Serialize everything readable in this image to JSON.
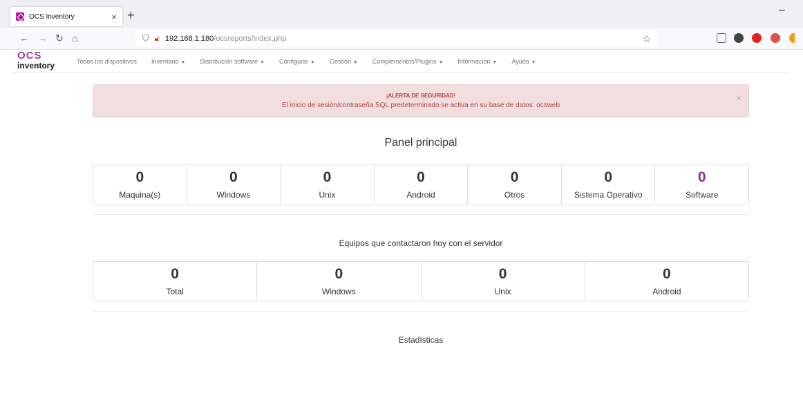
{
  "browser": {
    "tab_title": "OCS Inventory",
    "tab_close": "×",
    "new_tab": "+",
    "minimize": "–",
    "url_host": "192.168.1.180",
    "url_path": "/ocsreports/index.php"
  },
  "logo": {
    "top": "OCS",
    "bottom": "inventory"
  },
  "menu": [
    {
      "label": "Todos los dispositivos",
      "has_caret": false
    },
    {
      "label": "Inventario",
      "has_caret": true
    },
    {
      "label": "Distribución software",
      "has_caret": true
    },
    {
      "label": "Configurar",
      "has_caret": true
    },
    {
      "label": "Gestión",
      "has_caret": true
    },
    {
      "label": "Complementos/Plugins",
      "has_caret": true
    },
    {
      "label": "Información",
      "has_caret": true
    },
    {
      "label": "Ayuda",
      "has_caret": true
    }
  ],
  "alert": {
    "title": "¡ALERTA DE SEGURIDAD!",
    "message": "El inicio de sesión/contraseña SQL predeterminado se activa en su base de datos: ocsweb",
    "close": "×"
  },
  "dashboard": {
    "title": "Panel principal",
    "stats": [
      {
        "value": "0",
        "label": "Maquina(s)"
      },
      {
        "value": "0",
        "label": "Windows"
      },
      {
        "value": "0",
        "label": "Unix"
      },
      {
        "value": "0",
        "label": "Android"
      },
      {
        "value": "0",
        "label": "Otros"
      },
      {
        "value": "0",
        "label": "Sistema Operativo"
      },
      {
        "value": "0",
        "label": "Software"
      }
    ],
    "accent_color": "#8e2a8e"
  },
  "today": {
    "title": "Equipos que contactaron hoy con el servidor",
    "stats": [
      {
        "value": "0",
        "label": "Total"
      },
      {
        "value": "0",
        "label": "Windows"
      },
      {
        "value": "0",
        "label": "Unix"
      },
      {
        "value": "0",
        "label": "Android"
      }
    ]
  },
  "statistics": {
    "title": "Estadísticas"
  }
}
